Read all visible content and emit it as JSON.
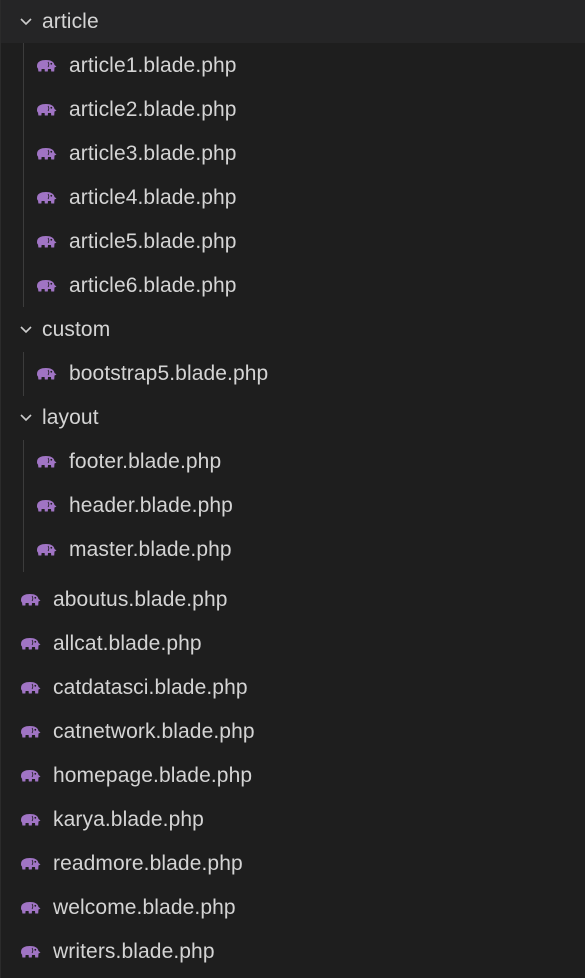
{
  "explorer": {
    "folders": [
      {
        "name": "article",
        "expanded": true
      },
      {
        "name": "custom",
        "expanded": true
      },
      {
        "name": "layout",
        "expanded": true
      }
    ],
    "article_files": [
      "article1.blade.php",
      "article2.blade.php",
      "article3.blade.php",
      "article4.blade.php",
      "article5.blade.php",
      "article6.blade.php"
    ],
    "custom_files": [
      "bootstrap5.blade.php"
    ],
    "layout_files": [
      "footer.blade.php",
      "header.blade.php",
      "master.blade.php"
    ],
    "root_files": [
      "aboutus.blade.php",
      "allcat.blade.php",
      "catdatasci.blade.php",
      "catnetwork.blade.php",
      "homepage.blade.php",
      "karya.blade.php",
      "readmore.blade.php",
      "welcome.blade.php",
      "writers.blade.php"
    ],
    "icon": "php-elephant-icon",
    "colors": {
      "background": "#1e1e1e",
      "header_background": "#252526",
      "icon": "#a074c4",
      "text": "#d4d4d4"
    }
  }
}
